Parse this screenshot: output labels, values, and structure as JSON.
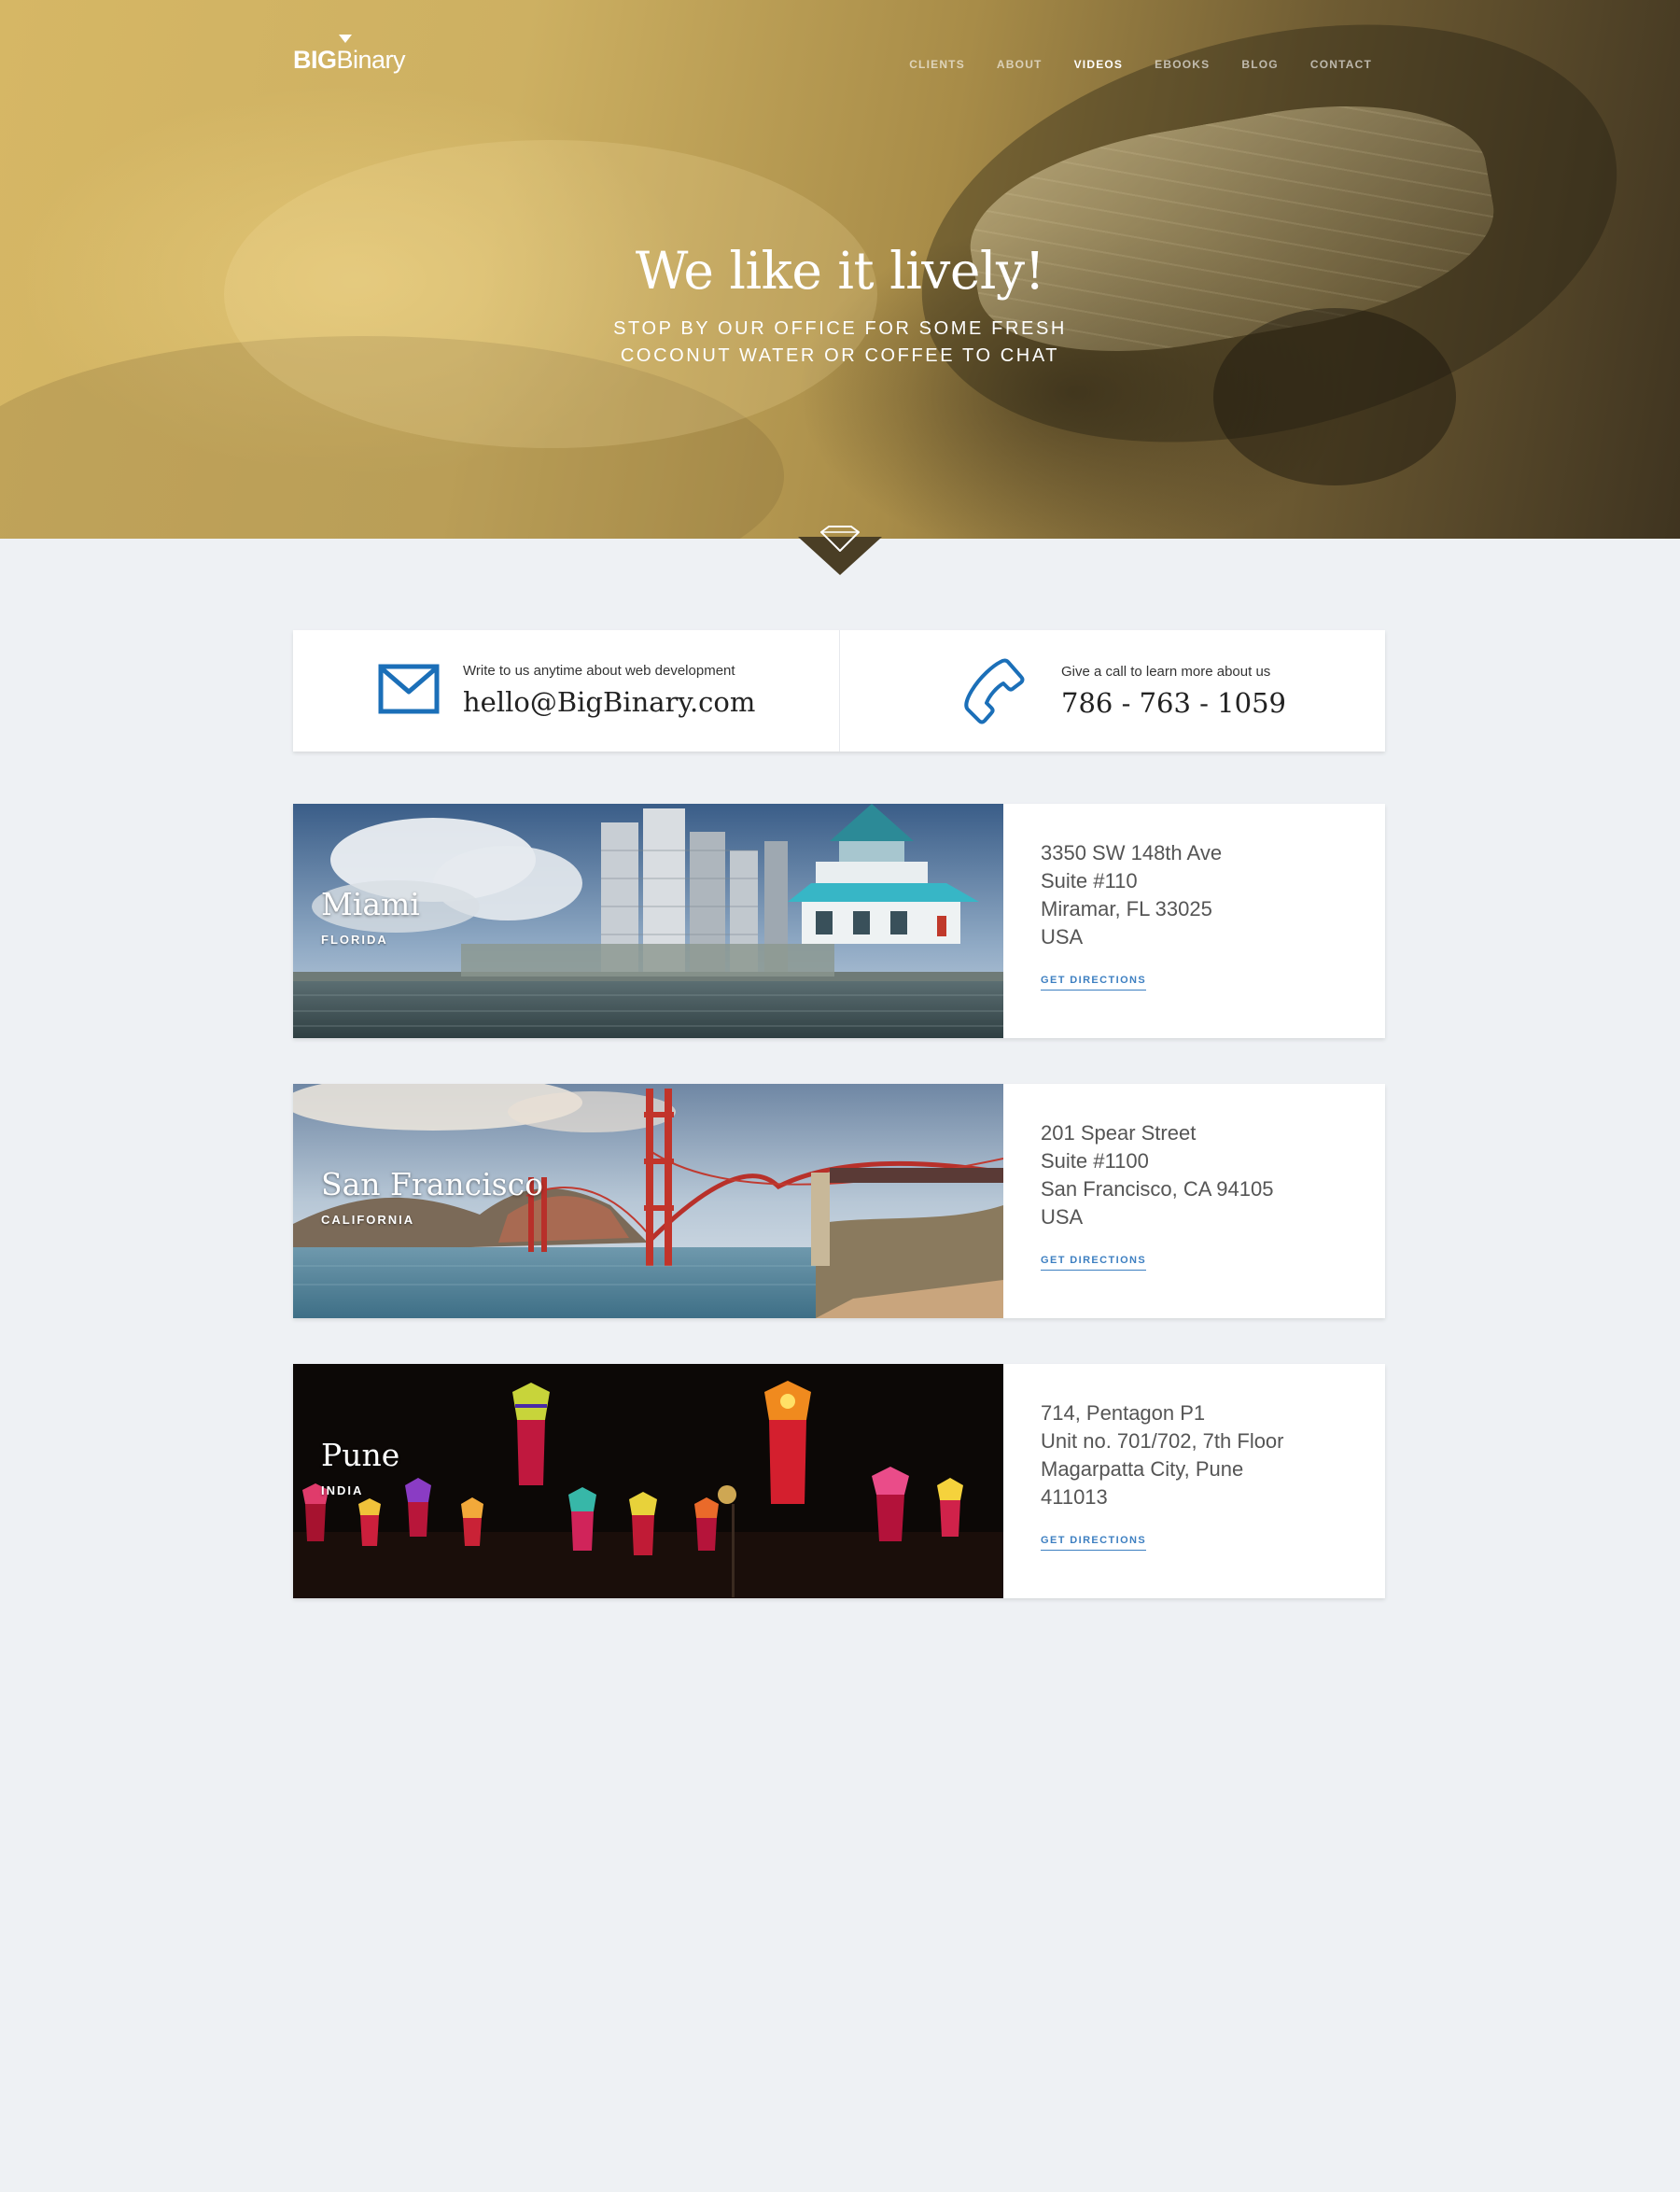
{
  "brand": {
    "logo_bold": "BIG",
    "logo_regular": "Binary"
  },
  "nav": {
    "items": [
      "CLIENTS",
      "ABOUT",
      "VIDEOS",
      "EBOOKS",
      "BLOG",
      "CONTACT"
    ],
    "active": "VIDEOS"
  },
  "hero": {
    "title": "We like it lively!",
    "subtitle_line1": "STOP BY OUR OFFICE FOR SOME FRESH",
    "subtitle_line2": "COCONUT WATER OR COFFEE TO CHAT"
  },
  "contact": {
    "email_caption": "Write to us anytime about web development",
    "email": "hello@BigBinary.com",
    "phone_caption": "Give a call to learn more about us",
    "phone": "786 - 763 - 1059"
  },
  "offices": [
    {
      "city": "Miami",
      "region": "FLORIDA",
      "address": [
        "3350 SW 148th Ave",
        "Suite #110",
        "Miramar, FL 33025",
        "USA"
      ],
      "link": "GET DIRECTIONS"
    },
    {
      "city": "San Francisco",
      "region": "CALIFORNIA",
      "address": [
        "201 Spear Street",
        "Suite #1100",
        "San Francisco, CA 94105",
        "USA"
      ],
      "link": "GET DIRECTIONS"
    },
    {
      "city": "Pune",
      "region": "INDIA",
      "address": [
        "714, Pentagon P1",
        "Unit no. 701/702, 7th Floor",
        "Magarpatta City, Pune",
        "411013"
      ],
      "link": "GET DIRECTIONS"
    }
  ],
  "colors": {
    "accent_blue": "#3d7fc1",
    "icon_blue": "#1b6fb8",
    "page_bg": "#eef1f4",
    "hero_tint": "#cdb062"
  },
  "icons": [
    "diamond-icon",
    "mail-icon",
    "phone-icon"
  ]
}
